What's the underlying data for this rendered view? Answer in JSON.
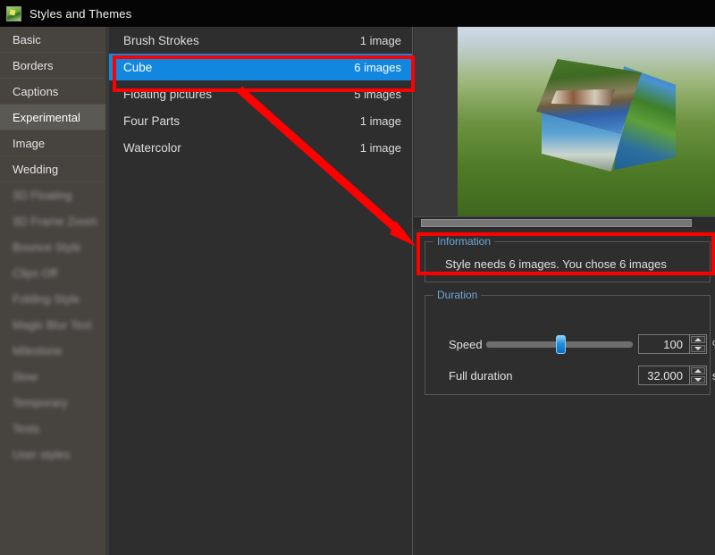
{
  "window": {
    "title": "Styles and Themes",
    "icon": "picture-style-icon"
  },
  "sidebar": {
    "items": [
      {
        "label": "Basic",
        "selected": false,
        "blurred": false
      },
      {
        "label": "Borders",
        "selected": false,
        "blurred": false
      },
      {
        "label": "Captions",
        "selected": false,
        "blurred": false
      },
      {
        "label": "Experimental",
        "selected": true,
        "blurred": false
      },
      {
        "label": "Image",
        "selected": false,
        "blurred": false
      },
      {
        "label": "Wedding",
        "selected": false,
        "blurred": false
      },
      {
        "label": "3D Floating",
        "selected": false,
        "blurred": true
      },
      {
        "label": "3D Frame Zoom",
        "selected": false,
        "blurred": true
      },
      {
        "label": "Bounce Style",
        "selected": false,
        "blurred": true
      },
      {
        "label": "Clips Off",
        "selected": false,
        "blurred": true
      },
      {
        "label": "Folding Style",
        "selected": false,
        "blurred": true
      },
      {
        "label": "Magic Blur Text",
        "selected": false,
        "blurred": true
      },
      {
        "label": "Milestone",
        "selected": false,
        "blurred": true
      },
      {
        "label": "Slow",
        "selected": false,
        "blurred": true
      },
      {
        "label": "Temporary",
        "selected": false,
        "blurred": true
      },
      {
        "label": "Tests",
        "selected": false,
        "blurred": true
      },
      {
        "label": "User styles",
        "selected": false,
        "blurred": true
      }
    ]
  },
  "styles_list": {
    "rows": [
      {
        "name": "Brush Strokes",
        "count": "1 image",
        "selected": false
      },
      {
        "name": "Cube",
        "count": "6 images",
        "selected": true
      },
      {
        "name": "Floating pictures",
        "count": "5 images",
        "selected": false
      },
      {
        "name": "Four Parts",
        "count": "1 image",
        "selected": false
      },
      {
        "name": "Watercolor",
        "count": "1 image",
        "selected": false
      }
    ]
  },
  "preview": {
    "name": "style-preview-cube"
  },
  "information": {
    "legend": "Information",
    "message": "Style needs 6 images. You chose 6 images"
  },
  "duration": {
    "legend": "Duration",
    "speed_label": "Speed",
    "speed_value": "100",
    "speed_unit": "%",
    "full_duration_label": "Full duration",
    "full_duration_value": "32.000",
    "full_duration_unit": "s"
  },
  "annotations": {
    "highlight_color": "#fe0000",
    "boxes": [
      "cube-row-highlight",
      "information-box-highlight"
    ],
    "arrow": "arrow-from-cube-to-information"
  },
  "colors": {
    "selection_blue": "#1287e0",
    "panel_background": "#2e2e2e",
    "sidebar_background": "#474440",
    "titlebar_background": "#050505",
    "legend_text": "#6fa8d8"
  }
}
